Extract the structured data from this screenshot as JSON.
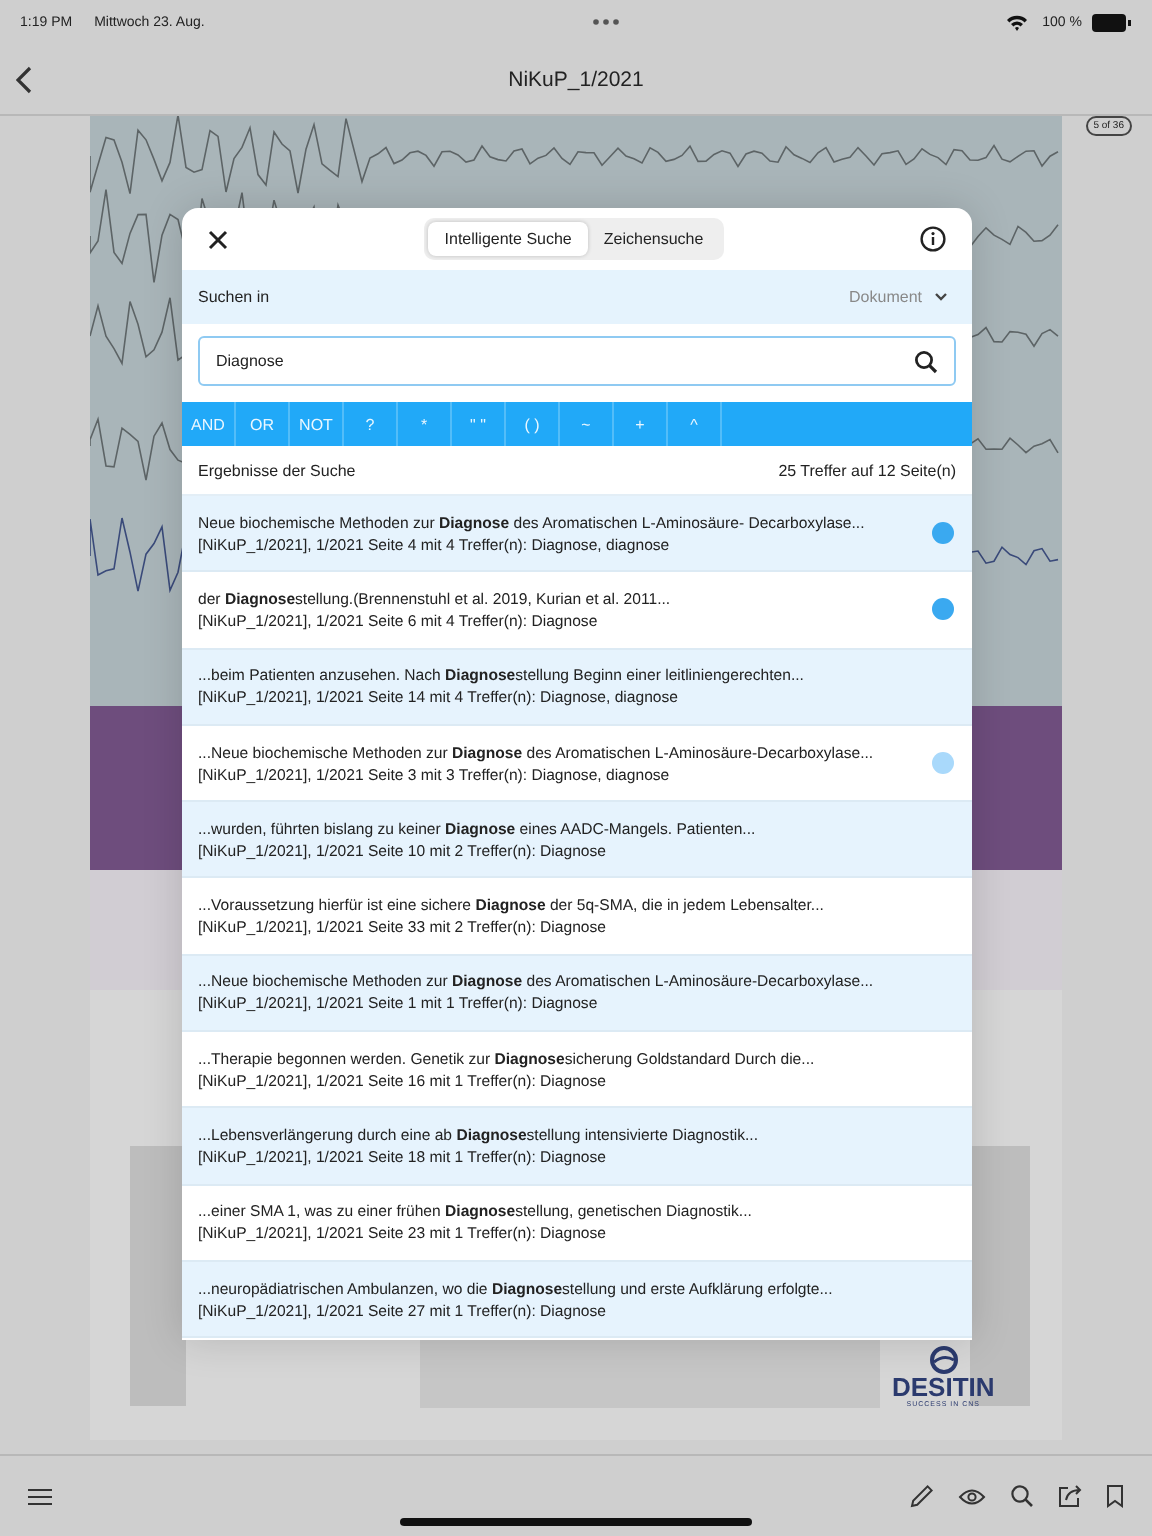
{
  "status_bar": {
    "time": "1:19 PM",
    "date": "Mittwoch 23. Aug.",
    "battery": "100 %"
  },
  "nav": {
    "title": "NiKuP_1/2021"
  },
  "document": {
    "page_badge": "5 of 36",
    "logo": "DESITIN",
    "logo_tagline": "SUCCESS IN CNS"
  },
  "search_panel": {
    "tabs": [
      {
        "label": "Intelligente Suche",
        "selected": true
      },
      {
        "label": "Zeichensuche",
        "selected": false
      }
    ],
    "scope_label": "Suchen in",
    "scope_value": "Dokument",
    "query": "Diagnose",
    "operators": [
      "AND",
      "OR",
      "NOT",
      "?",
      "*",
      "\" \"",
      "( )",
      "~",
      "+",
      "^"
    ],
    "results_label": "Ergebnisse der Suche",
    "results_count": "25 Treffer auf 12 Seite(n)",
    "results": [
      {
        "snippet": "Neue biochemische Methoden zur **Diagnose** des Aromatischen L-Aminosäure- Decarboxylase...",
        "source": "[NiKuP_1/2021], 1/2021 Seite 4 mit 4 Treffer(n): Diagnose, diagnose",
        "color": "#3aa9f0"
      },
      {
        "snippet": "der **Diagnose**stellung.(Brennenstuhl et al. 2019, Kurian et al. 2011...",
        "source": "[NiKuP_1/2021], 1/2021 Seite 6 mit 4 Treffer(n): Diagnose",
        "color": "#3aa9f0"
      },
      {
        "snippet": "...beim Patienten anzusehen. Nach **Diagnose**stellung Beginn einer leitliniengerechten...",
        "source": "[NiKuP_1/2021], 1/2021 Seite 14 mit 4 Treffer(n): Diagnose, diagnose"
      },
      {
        "snippet": "...Neue biochemische Methoden zur **Diagnose** des Aromatischen L-Aminosäure-Decarboxylase...",
        "source": "[NiKuP_1/2021], 1/2021 Seite 3 mit 3 Treffer(n): Diagnose, diagnose",
        "color": "#a9d9fb"
      },
      {
        "snippet": "...wurden, führten bislang zu keiner **Diagnose** eines AADC-Mangels. Patienten...",
        "source": "[NiKuP_1/2021], 1/2021 Seite 10 mit 2 Treffer(n): Diagnose"
      },
      {
        "snippet": "...Voraussetzung hierfür ist eine sichere **Diagnose** der 5q-SMA, die in jedem Lebensalter...",
        "source": "[NiKuP_1/2021], 1/2021 Seite 33 mit 2 Treffer(n): Diagnose"
      },
      {
        "snippet": "...Neue biochemische Methoden zur **Diagnose** des Aromatischen L-Aminosäure-Decarboxylase...",
        "source": "[NiKuP_1/2021], 1/2021 Seite 1 mit 1 Treffer(n): Diagnose"
      },
      {
        "snippet": "...Therapie begonnen werden. Genetik zur **Diagnose**sicherung Goldstandard Durch die...",
        "source": "[NiKuP_1/2021], 1/2021 Seite 16 mit 1 Treffer(n): Diagnose"
      },
      {
        "snippet": "...Lebensverlängerung durch eine ab **Diagnose**stellung intensivierte Diagnostik...",
        "source": "[NiKuP_1/2021], 1/2021 Seite 18 mit 1 Treffer(n): Diagnose"
      },
      {
        "snippet": "...einer SMA 1, was zu einer frühen **Diagnose**stellung, genetischen Diagnostik...",
        "source": "[NiKuP_1/2021], 1/2021 Seite 23 mit 1 Treffer(n): Diagnose"
      },
      {
        "snippet": "...neuropädiatrischen Ambulanzen, wo die **Diagnose**stellung und erste Aufklärung erfolgte...",
        "source": "[NiKuP_1/2021], 1/2021 Seite 27 mit 1 Treffer(n): Diagnose"
      }
    ]
  }
}
